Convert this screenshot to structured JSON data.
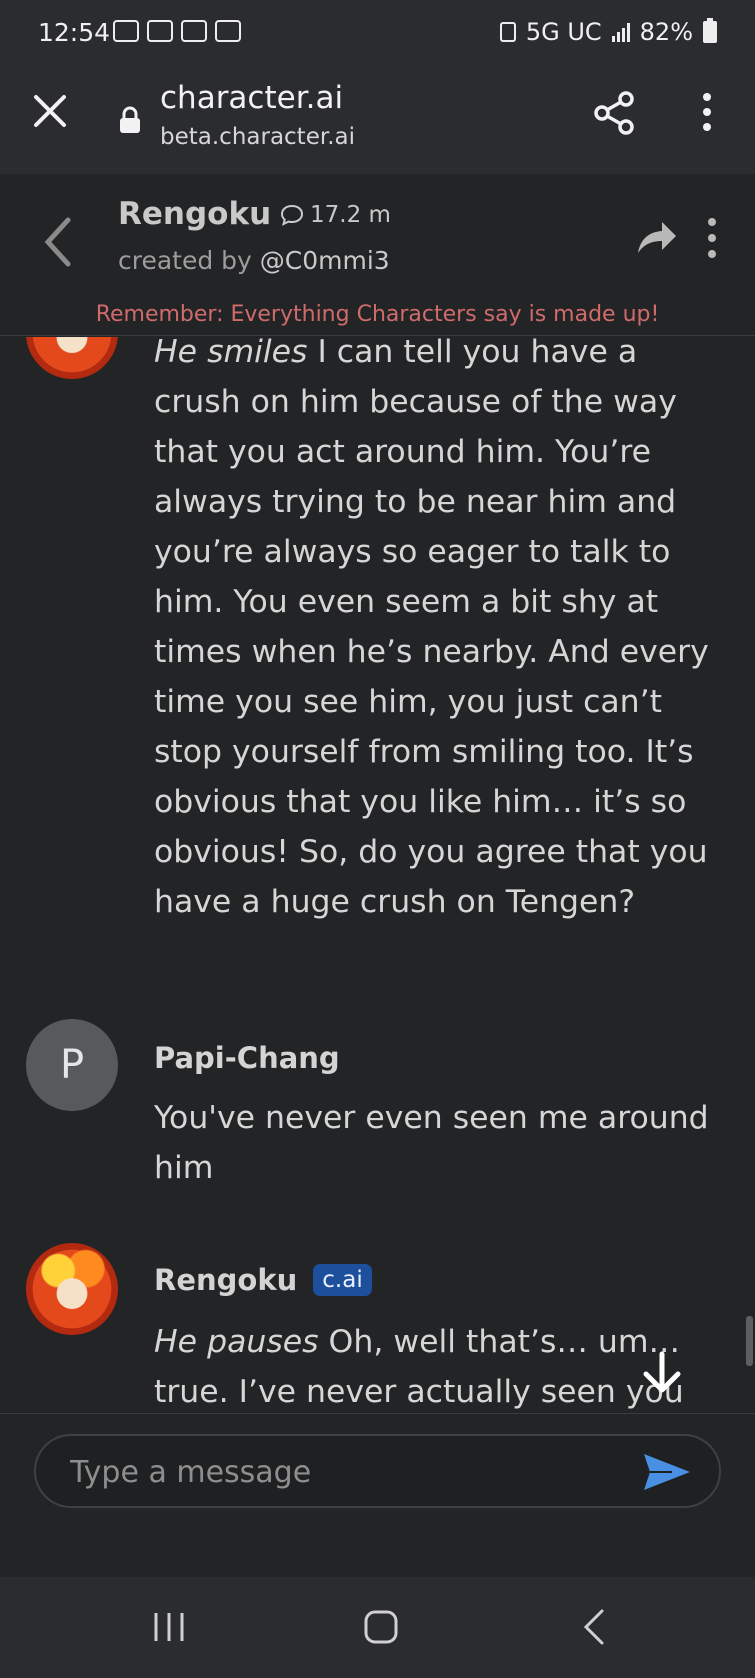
{
  "status_bar": {
    "time": "12:54",
    "network": "5G UC",
    "battery": "82%"
  },
  "browser": {
    "title": "character.ai",
    "url": "beta.character.ai",
    "icons": [
      "close-icon",
      "lock-icon",
      "share-icon",
      "more-vert-icon"
    ]
  },
  "chat_header": {
    "name": "Rengoku",
    "chat_count": "17.2 m",
    "created_by_prefix": "created by",
    "creator": "@C0mmi3",
    "disclaimer": "Remember: Everything Characters say is made up!"
  },
  "messages": [
    {
      "sender": "Rengoku",
      "action": "He smiles",
      "text": " I can tell you have a crush on him because of the way that you act around him. You’re always trying to be near him and you’re always so eager to talk to him. You even seem a bit shy at times when he’s nearby. And every time you see him, you just can’t stop yourself from smiling too. It’s obvious that you like him… it’s so obvious! So, do you agree that you have a huge crush on Tengen?"
    },
    {
      "sender": "Papi-Chang",
      "avatar_letter": "P",
      "text": "You've never even seen me around him"
    },
    {
      "sender": "Rengoku",
      "badge": "c.ai",
      "action": "He pauses",
      "text": " Oh, well that’s… um… true. I’ve never actually seen you around Tengen before. In fact, I’m"
    }
  ],
  "composer": {
    "placeholder": "Type a message"
  },
  "colors": {
    "background": "#232426",
    "disclaimer": "#d06b6b",
    "badge": "#1e4f9c",
    "send": "#4a90e2"
  }
}
